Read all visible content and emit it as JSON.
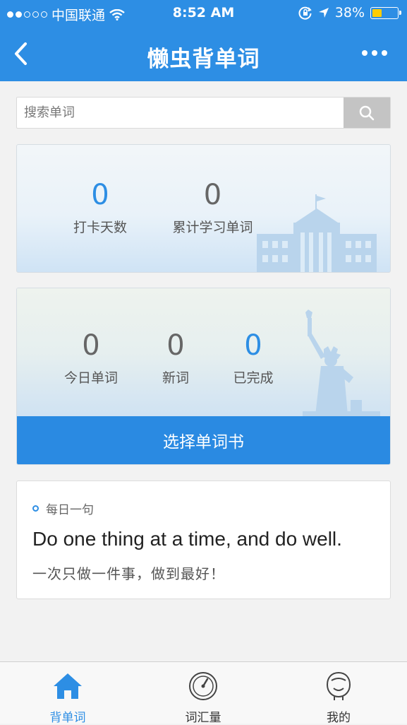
{
  "status_bar": {
    "carrier": "中国联通",
    "time": "8:52 AM",
    "battery": "38%",
    "battery_level": 0.38
  },
  "nav": {
    "title": "懒虫背单词"
  },
  "search": {
    "placeholder": "搜索单词"
  },
  "summary": {
    "checkin_days": {
      "value": "0",
      "label": "打卡天数"
    },
    "total_words": {
      "value": "0",
      "label": "累计学习单词"
    }
  },
  "today": {
    "today_words": {
      "value": "0",
      "label": "今日单词"
    },
    "new_words": {
      "value": "0",
      "label": "新词"
    },
    "completed": {
      "value": "0",
      "label": "已完成"
    },
    "choose_button": "选择单词书"
  },
  "daily": {
    "heading": "每日一句",
    "english": "Do one thing at a time, and do well.",
    "chinese": "一次只做一件事，做到最好！"
  },
  "tabs": [
    {
      "label": "背单词",
      "icon": "home-icon",
      "active": true
    },
    {
      "label": "词汇量",
      "icon": "gauge-icon",
      "active": false
    },
    {
      "label": "我的",
      "icon": "profile-icon",
      "active": false
    }
  ],
  "colors": {
    "primary": "#2d8ee4",
    "battery_fill": "#ffcc00"
  }
}
